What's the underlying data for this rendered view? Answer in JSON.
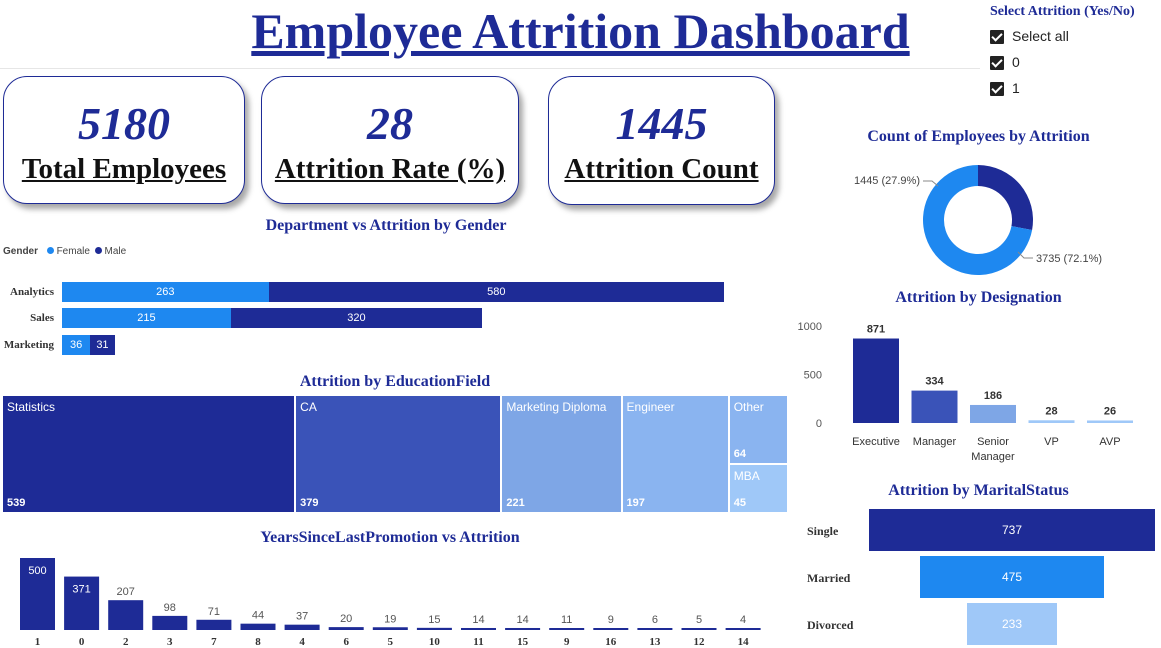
{
  "title": "Employee Attrition Dashboard",
  "slicer": {
    "title": "Select Attrition (Yes/No)",
    "options": [
      "Select all",
      "0",
      "1"
    ]
  },
  "kpis": [
    {
      "value": "5180",
      "label": "Total Employees"
    },
    {
      "value": "28",
      "label": "Attrition Rate (%)"
    },
    {
      "value": "1445",
      "label": "Attrition Count"
    }
  ],
  "colors": {
    "dark_blue": "#1e2b96",
    "mid_blue": "#3a53b8",
    "light_blue": "#1e88f0",
    "pale_blue": "#7ea6e6",
    "paler_blue": "#8ab4f0",
    "palest_blue": "#9fc8f8"
  },
  "chart_data": [
    {
      "id": "dept_gender",
      "type": "bar",
      "title": "Department vs Attrition by Gender",
      "legend_title": "Gender",
      "categories": [
        "Analytics",
        "Sales",
        "Marketing"
      ],
      "series": [
        {
          "name": "Female",
          "values": [
            263,
            215,
            36
          ],
          "color": "#1e88f0"
        },
        {
          "name": "Male",
          "values": [
            580,
            320,
            31
          ],
          "color": "#1e2b96"
        }
      ]
    },
    {
      "id": "education",
      "type": "treemap",
      "title": "Attrition by EducationField",
      "categories": [
        "Statistics",
        "CA",
        "Marketing Diploma",
        "Engineer",
        "Other",
        "MBA"
      ],
      "values": [
        539,
        379,
        221,
        197,
        64,
        45
      ]
    },
    {
      "id": "promotion",
      "type": "bar",
      "title": "YearsSinceLastPromotion vs Attrition",
      "categories": [
        "1",
        "0",
        "2",
        "3",
        "7",
        "8",
        "4",
        "6",
        "5",
        "10",
        "11",
        "15",
        "9",
        "16",
        "13",
        "12",
        "14"
      ],
      "values": [
        500,
        371,
        207,
        98,
        71,
        44,
        37,
        20,
        19,
        15,
        14,
        14,
        11,
        9,
        6,
        5,
        4
      ]
    },
    {
      "id": "attrition_donut",
      "type": "pie",
      "title": "Count of Employees by Attrition",
      "values": [
        1445,
        3735
      ],
      "labels": [
        "1445 (27.9%)",
        "3735 (72.1%)"
      ]
    },
    {
      "id": "designation",
      "type": "bar",
      "title": "Attrition by Designation",
      "categories": [
        "Executive",
        "Manager",
        "Senior Manager",
        "VP",
        "AVP"
      ],
      "values": [
        871,
        334,
        186,
        28,
        26
      ],
      "yticks": [
        0,
        500,
        1000
      ],
      "ylim": [
        0,
        1000
      ]
    },
    {
      "id": "marital",
      "type": "bar",
      "title": "Attrition by MaritalStatus",
      "categories": [
        "Single",
        "Married",
        "Divorced"
      ],
      "values": [
        737,
        475,
        233
      ]
    }
  ]
}
